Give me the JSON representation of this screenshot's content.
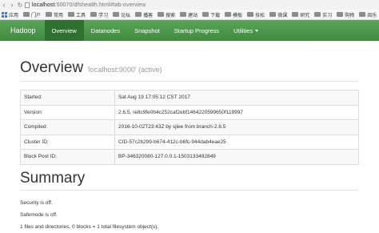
{
  "browser": {
    "back_icon": "back-arrow-icon",
    "forward_icon": "forward-arrow-icon",
    "reload_icon": "reload-icon",
    "url_host": "localhost",
    "url_rest": ":50070/dfshealth.html#tab-overview"
  },
  "bookmarks": [
    {
      "label": "应用",
      "icon": "apps-grid-icon"
    },
    {
      "label": "门户",
      "icon": "folder-icon"
    },
    {
      "label": "常用",
      "icon": "folder-icon"
    },
    {
      "label": "工具",
      "icon": "folder-icon"
    },
    {
      "label": "学习",
      "icon": "folder-icon"
    },
    {
      "label": "论坛",
      "icon": "folder-icon"
    },
    {
      "label": "播客",
      "icon": "folder-icon"
    },
    {
      "label": "搜索",
      "icon": "folder-icon"
    },
    {
      "label": "建站",
      "icon": "folder-icon"
    },
    {
      "label": "下载",
      "icon": "folder-icon"
    },
    {
      "label": "模板",
      "icon": "folder-icon"
    },
    {
      "label": "技松",
      "icon": "folder-icon"
    },
    {
      "label": "微课",
      "icon": "folder-icon"
    },
    {
      "label": "研究",
      "icon": "folder-icon"
    },
    {
      "label": "实习",
      "icon": "folder-icon"
    },
    {
      "label": "购物",
      "icon": "folder-icon"
    },
    {
      "label": "阅乐",
      "icon": "folder-icon"
    }
  ],
  "navbar": {
    "brand": "Hadoop",
    "items": [
      {
        "label": "Overview",
        "active": true
      },
      {
        "label": "Datanodes"
      },
      {
        "label": "Snapshot"
      },
      {
        "label": "Startup Progress"
      },
      {
        "label": "Utilities",
        "has_caret": true
      }
    ],
    "background": "#479447",
    "active_background": "#2f6f2f"
  },
  "overview": {
    "title": "Overview",
    "subtitle": "'localhost:9000' (active)",
    "rows": [
      {
        "label": "Started:",
        "value": "Sat Aug 19 17:05:12 CST 2017"
      },
      {
        "label": "Version:",
        "value": "2.6.5, re8c9fe0b4c252caf2ebf1464220599650f119997"
      },
      {
        "label": "Compiled:",
        "value": "2016-10-02T23:43Z by sjlee from branch-2.6.5"
      },
      {
        "label": "Cluster ID:",
        "value": "CID-57c2b299-b674-412c-b6fc-944dab4eae25"
      },
      {
        "label": "Block Pool ID:",
        "value": "BP-346320080-127.0.0.1-1503133492849"
      }
    ]
  },
  "summary": {
    "title": "Summary",
    "lines": [
      "Security is off.",
      "Safemode is off.",
      "1 files and directories, 0 blocks = 1 total filesystem object(s)."
    ]
  }
}
